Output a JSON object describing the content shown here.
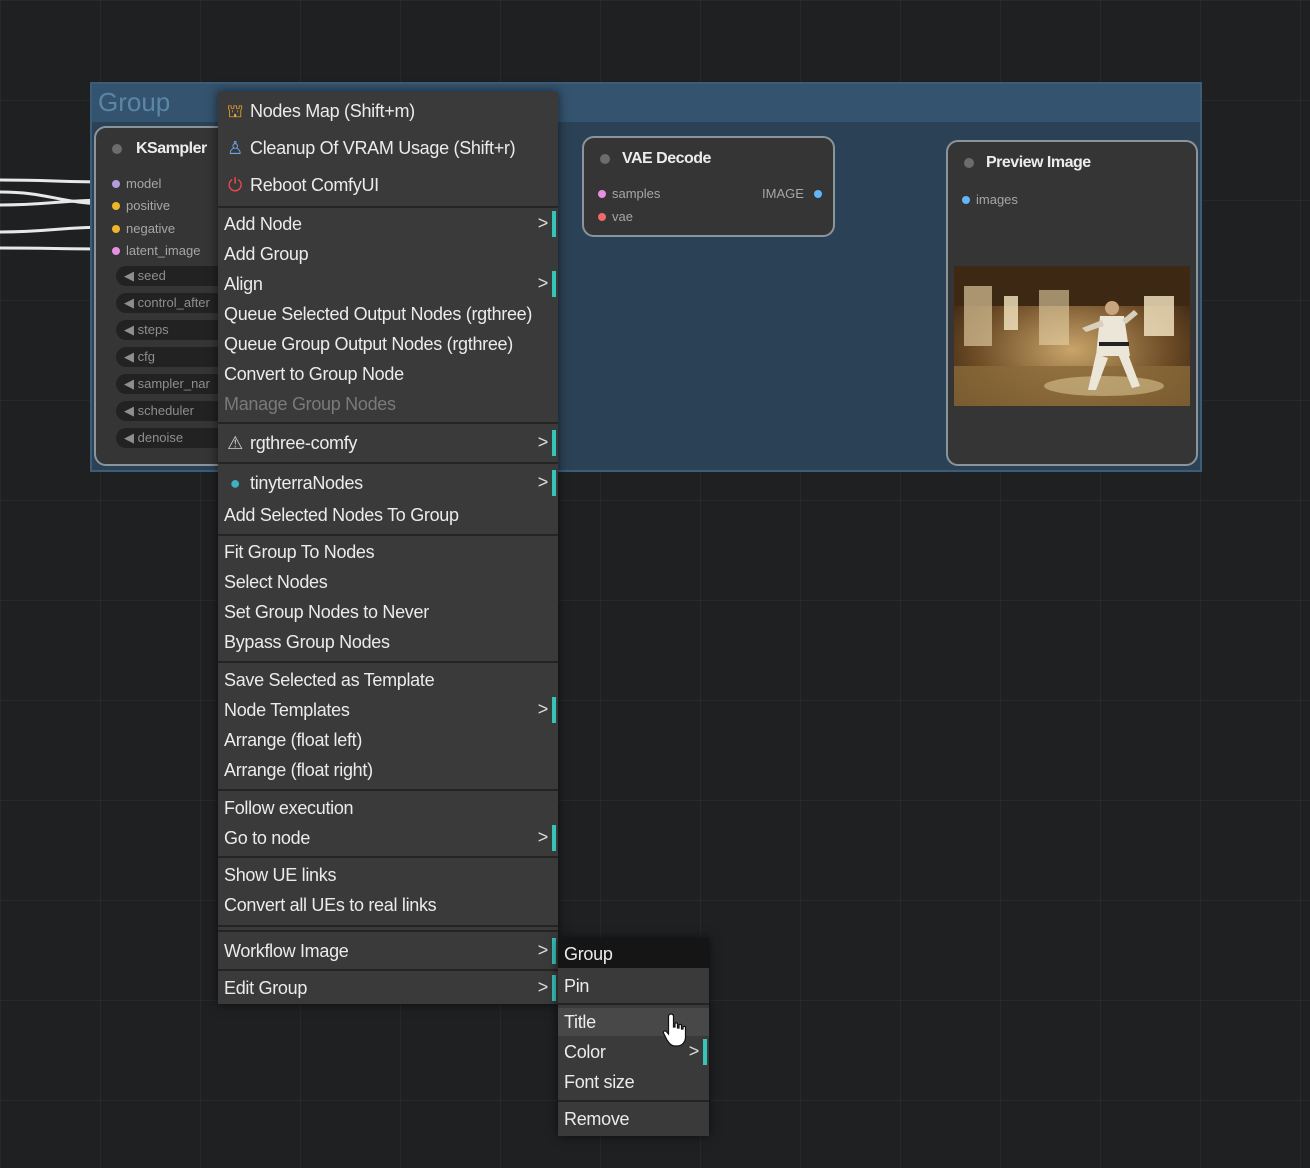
{
  "group": {
    "title": "Group"
  },
  "nodes": {
    "ksampler": {
      "title": "KSampler",
      "inputs": [
        "model",
        "positive",
        "negative",
        "latent_image"
      ],
      "widgets": [
        "seed",
        "control_after",
        "steps",
        "cfg",
        "sampler_nar",
        "scheduler",
        "denoise"
      ]
    },
    "vae_decode": {
      "title": "VAE Decode",
      "inputs": [
        "samples",
        "vae"
      ],
      "outputs": [
        "IMAGE"
      ]
    },
    "preview_image": {
      "title": "Preview Image",
      "inputs": [
        "images"
      ]
    }
  },
  "menu": {
    "items": [
      {
        "label": "Nodes Map (Shift+m)",
        "icon": "sitemap-icon"
      },
      {
        "label": "Cleanup Of VRAM Usage (Shift+r)",
        "icon": "cleanup-icon"
      },
      {
        "label": "Reboot ComfyUI",
        "icon": "reboot-icon"
      },
      {
        "label": "Add Node",
        "submenu": true
      },
      {
        "label": "Add Group"
      },
      {
        "label": "Align",
        "submenu": true
      },
      {
        "label": "Queue Selected Output Nodes (rgthree)"
      },
      {
        "label": "Queue Group Output Nodes (rgthree)"
      },
      {
        "label": "Convert to Group Node"
      },
      {
        "label": "Manage Group Nodes",
        "disabled": true
      },
      {
        "label": "rgthree-comfy",
        "icon": "rgthree-icon",
        "submenu": true
      },
      {
        "label": "tinyterraNodes",
        "icon": "globe-icon",
        "submenu": true
      },
      {
        "label": "Add Selected Nodes To Group"
      },
      {
        "label": "Fit Group To Nodes"
      },
      {
        "label": "Select Nodes"
      },
      {
        "label": "Set Group Nodes to Never"
      },
      {
        "label": "Bypass Group Nodes"
      },
      {
        "label": "Save Selected as Template"
      },
      {
        "label": "Node Templates",
        "submenu": true
      },
      {
        "label": "Arrange (float left)"
      },
      {
        "label": "Arrange (float right)"
      },
      {
        "label": "Follow execution"
      },
      {
        "label": "Go to node",
        "submenu": true
      },
      {
        "label": "Show UE links"
      },
      {
        "label": "Convert all UEs to real links"
      },
      {
        "label": "Workflow Image",
        "submenu": true
      },
      {
        "label": "Edit Group",
        "submenu": true
      }
    ],
    "arrow_glyph": ">"
  },
  "submenu": {
    "header": "Group",
    "items": [
      "Pin",
      "Title",
      "Color",
      "Font size",
      "Remove"
    ],
    "hovered": "Title"
  },
  "colors": {
    "accent": "#35c4b8",
    "group_bg": "#2b4256",
    "menu_bg": "#3a3a3a"
  }
}
